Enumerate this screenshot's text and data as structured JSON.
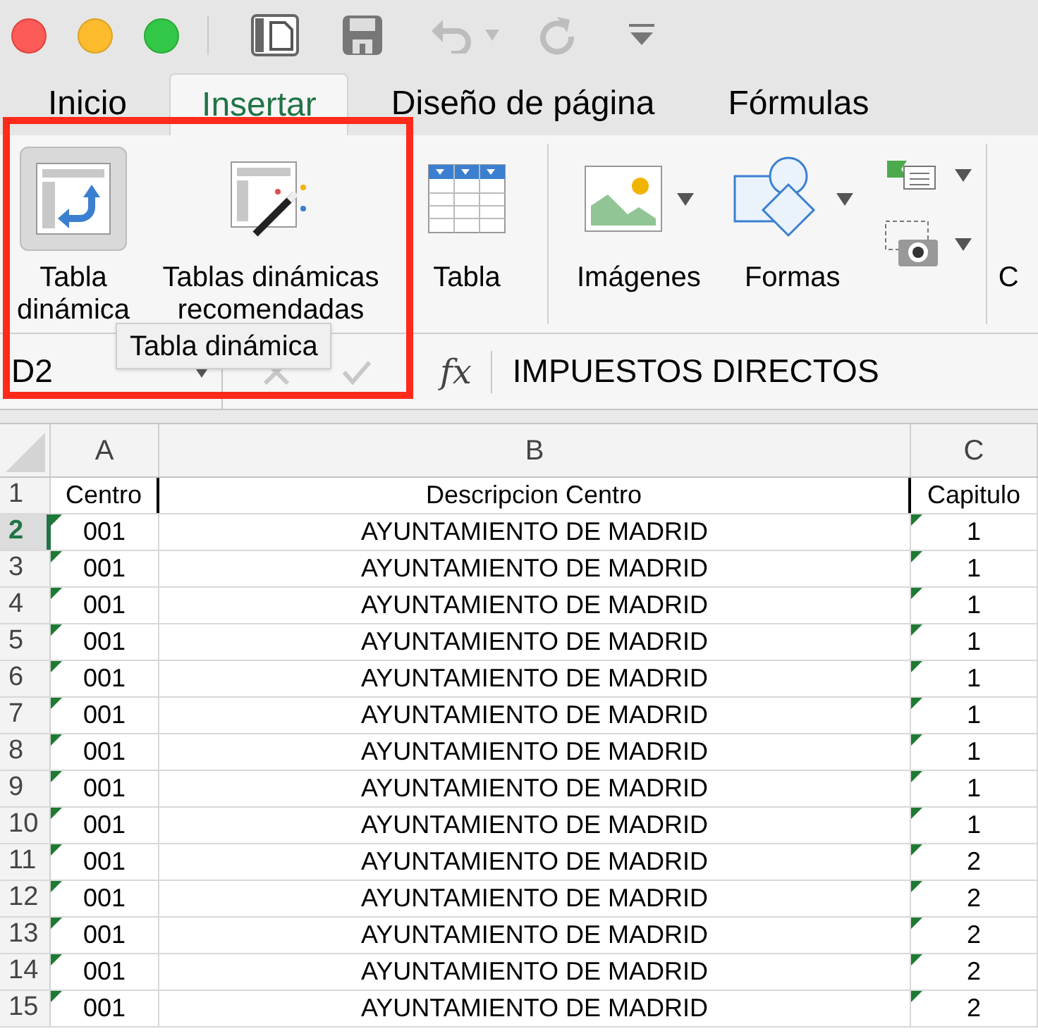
{
  "tabs": [
    {
      "label": "Inicio",
      "selected": false
    },
    {
      "label": "Insertar",
      "selected": true
    },
    {
      "label": "Diseño de página",
      "selected": false
    },
    {
      "label": "Fórmulas",
      "selected": false
    }
  ],
  "ribbon": {
    "groups": [
      {
        "items": [
          {
            "kind": "pivot",
            "lines": [
              "Tabla",
              "dinámica"
            ],
            "pressed": true
          },
          {
            "kind": "recommended",
            "lines": [
              "Tablas dinámicas",
              "recomendadas"
            ],
            "pressed": false
          },
          {
            "kind": "table",
            "lines": [
              "Tabla"
            ],
            "pressed": false
          }
        ]
      },
      {
        "items": [
          {
            "kind": "images",
            "lines": [
              "Imágenes"
            ]
          },
          {
            "kind": "shapes",
            "lines": [
              "Formas"
            ]
          },
          {
            "kind": "smallstack"
          }
        ]
      },
      {
        "items": [
          {
            "kind": "cut",
            "lines": [
              "C"
            ]
          }
        ]
      }
    ]
  },
  "tooltip": "Tabla dinámica",
  "formula_bar": {
    "name_box": "D2",
    "function_label": "fx",
    "formula": "IMPUESTOS DIRECTOS"
  },
  "sheet": {
    "columns": [
      "A",
      "B",
      "C"
    ],
    "header": {
      "number": "1",
      "cells": [
        "Centro",
        "Descripcion Centro",
        "Capitulo"
      ]
    },
    "rows": [
      {
        "number": "2",
        "selected": true,
        "cells": [
          "001",
          "AYUNTAMIENTO DE MADRID",
          "1"
        ]
      },
      {
        "number": "3",
        "selected": false,
        "cells": [
          "001",
          "AYUNTAMIENTO DE MADRID",
          "1"
        ]
      },
      {
        "number": "4",
        "selected": false,
        "cells": [
          "001",
          "AYUNTAMIENTO DE MADRID",
          "1"
        ]
      },
      {
        "number": "5",
        "selected": false,
        "cells": [
          "001",
          "AYUNTAMIENTO DE MADRID",
          "1"
        ]
      },
      {
        "number": "6",
        "selected": false,
        "cells": [
          "001",
          "AYUNTAMIENTO DE MADRID",
          "1"
        ]
      },
      {
        "number": "7",
        "selected": false,
        "cells": [
          "001",
          "AYUNTAMIENTO DE MADRID",
          "1"
        ]
      },
      {
        "number": "8",
        "selected": false,
        "cells": [
          "001",
          "AYUNTAMIENTO DE MADRID",
          "1"
        ]
      },
      {
        "number": "9",
        "selected": false,
        "cells": [
          "001",
          "AYUNTAMIENTO DE MADRID",
          "1"
        ]
      },
      {
        "number": "10",
        "selected": false,
        "cells": [
          "001",
          "AYUNTAMIENTO DE MADRID",
          "1"
        ]
      },
      {
        "number": "11",
        "selected": false,
        "cells": [
          "001",
          "AYUNTAMIENTO DE MADRID",
          "2"
        ]
      },
      {
        "number": "12",
        "selected": false,
        "cells": [
          "001",
          "AYUNTAMIENTO DE MADRID",
          "2"
        ]
      },
      {
        "number": "13",
        "selected": false,
        "cells": [
          "001",
          "AYUNTAMIENTO DE MADRID",
          "2"
        ]
      },
      {
        "number": "14",
        "selected": false,
        "cells": [
          "001",
          "AYUNTAMIENTO DE MADRID",
          "2"
        ]
      },
      {
        "number": "15",
        "selected": false,
        "cells": [
          "001",
          "AYUNTAMIENTO DE MADRID",
          "2"
        ]
      }
    ]
  }
}
